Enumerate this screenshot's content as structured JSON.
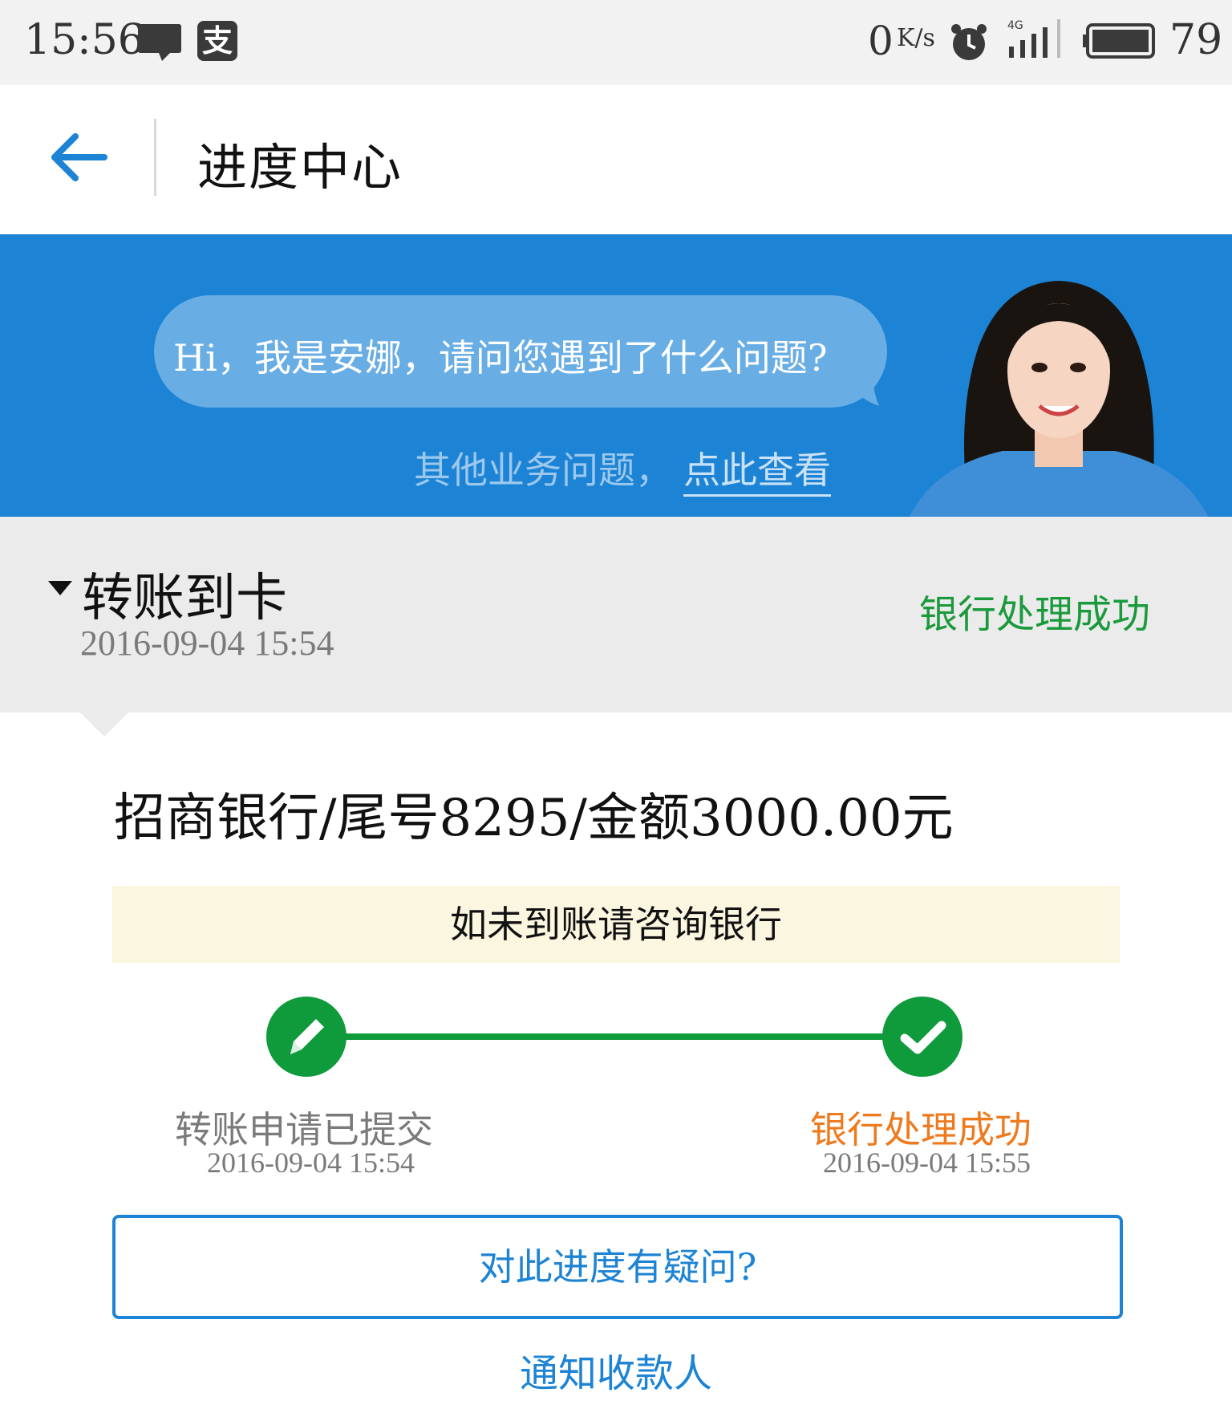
{
  "status_bar": {
    "time": "15:56",
    "app_icon_char": "支",
    "net_speed": "0",
    "net_unit": "K/s",
    "network_type": "4G",
    "battery": "79",
    "icons": [
      "message-icon",
      "alipay-icon",
      "alarm-icon",
      "signal-icon",
      "battery-icon"
    ]
  },
  "header": {
    "title": "进度中心",
    "back_icon": "back-arrow-icon"
  },
  "banner": {
    "greeting": "Hi，我是安娜，请问您遇到了什么问题?",
    "other_prefix": "其他业务问题，",
    "other_link": "点此查看",
    "background_color": "#1d83d4"
  },
  "summary": {
    "title": "转账到卡",
    "time": "2016-09-04 15:54",
    "status": "银行处理成功",
    "status_color": "#1a9a3c"
  },
  "detail": {
    "line": "招商银行/尾号8295/金额3000.00元",
    "notice": "如未到账请咨询银行"
  },
  "progress": {
    "steps": [
      {
        "label": "转账申请已提交",
        "time": "2016-09-04 15:54",
        "icon": "pencil-icon"
      },
      {
        "label": "银行处理成功",
        "time": "2016-09-04 15:55",
        "icon": "check-icon"
      }
    ],
    "accent_color": "#0f9a3c",
    "highlight_color": "#ef7a1e"
  },
  "actions": {
    "question_button": "对此进度有疑问?",
    "notify_link": "通知收款人"
  }
}
